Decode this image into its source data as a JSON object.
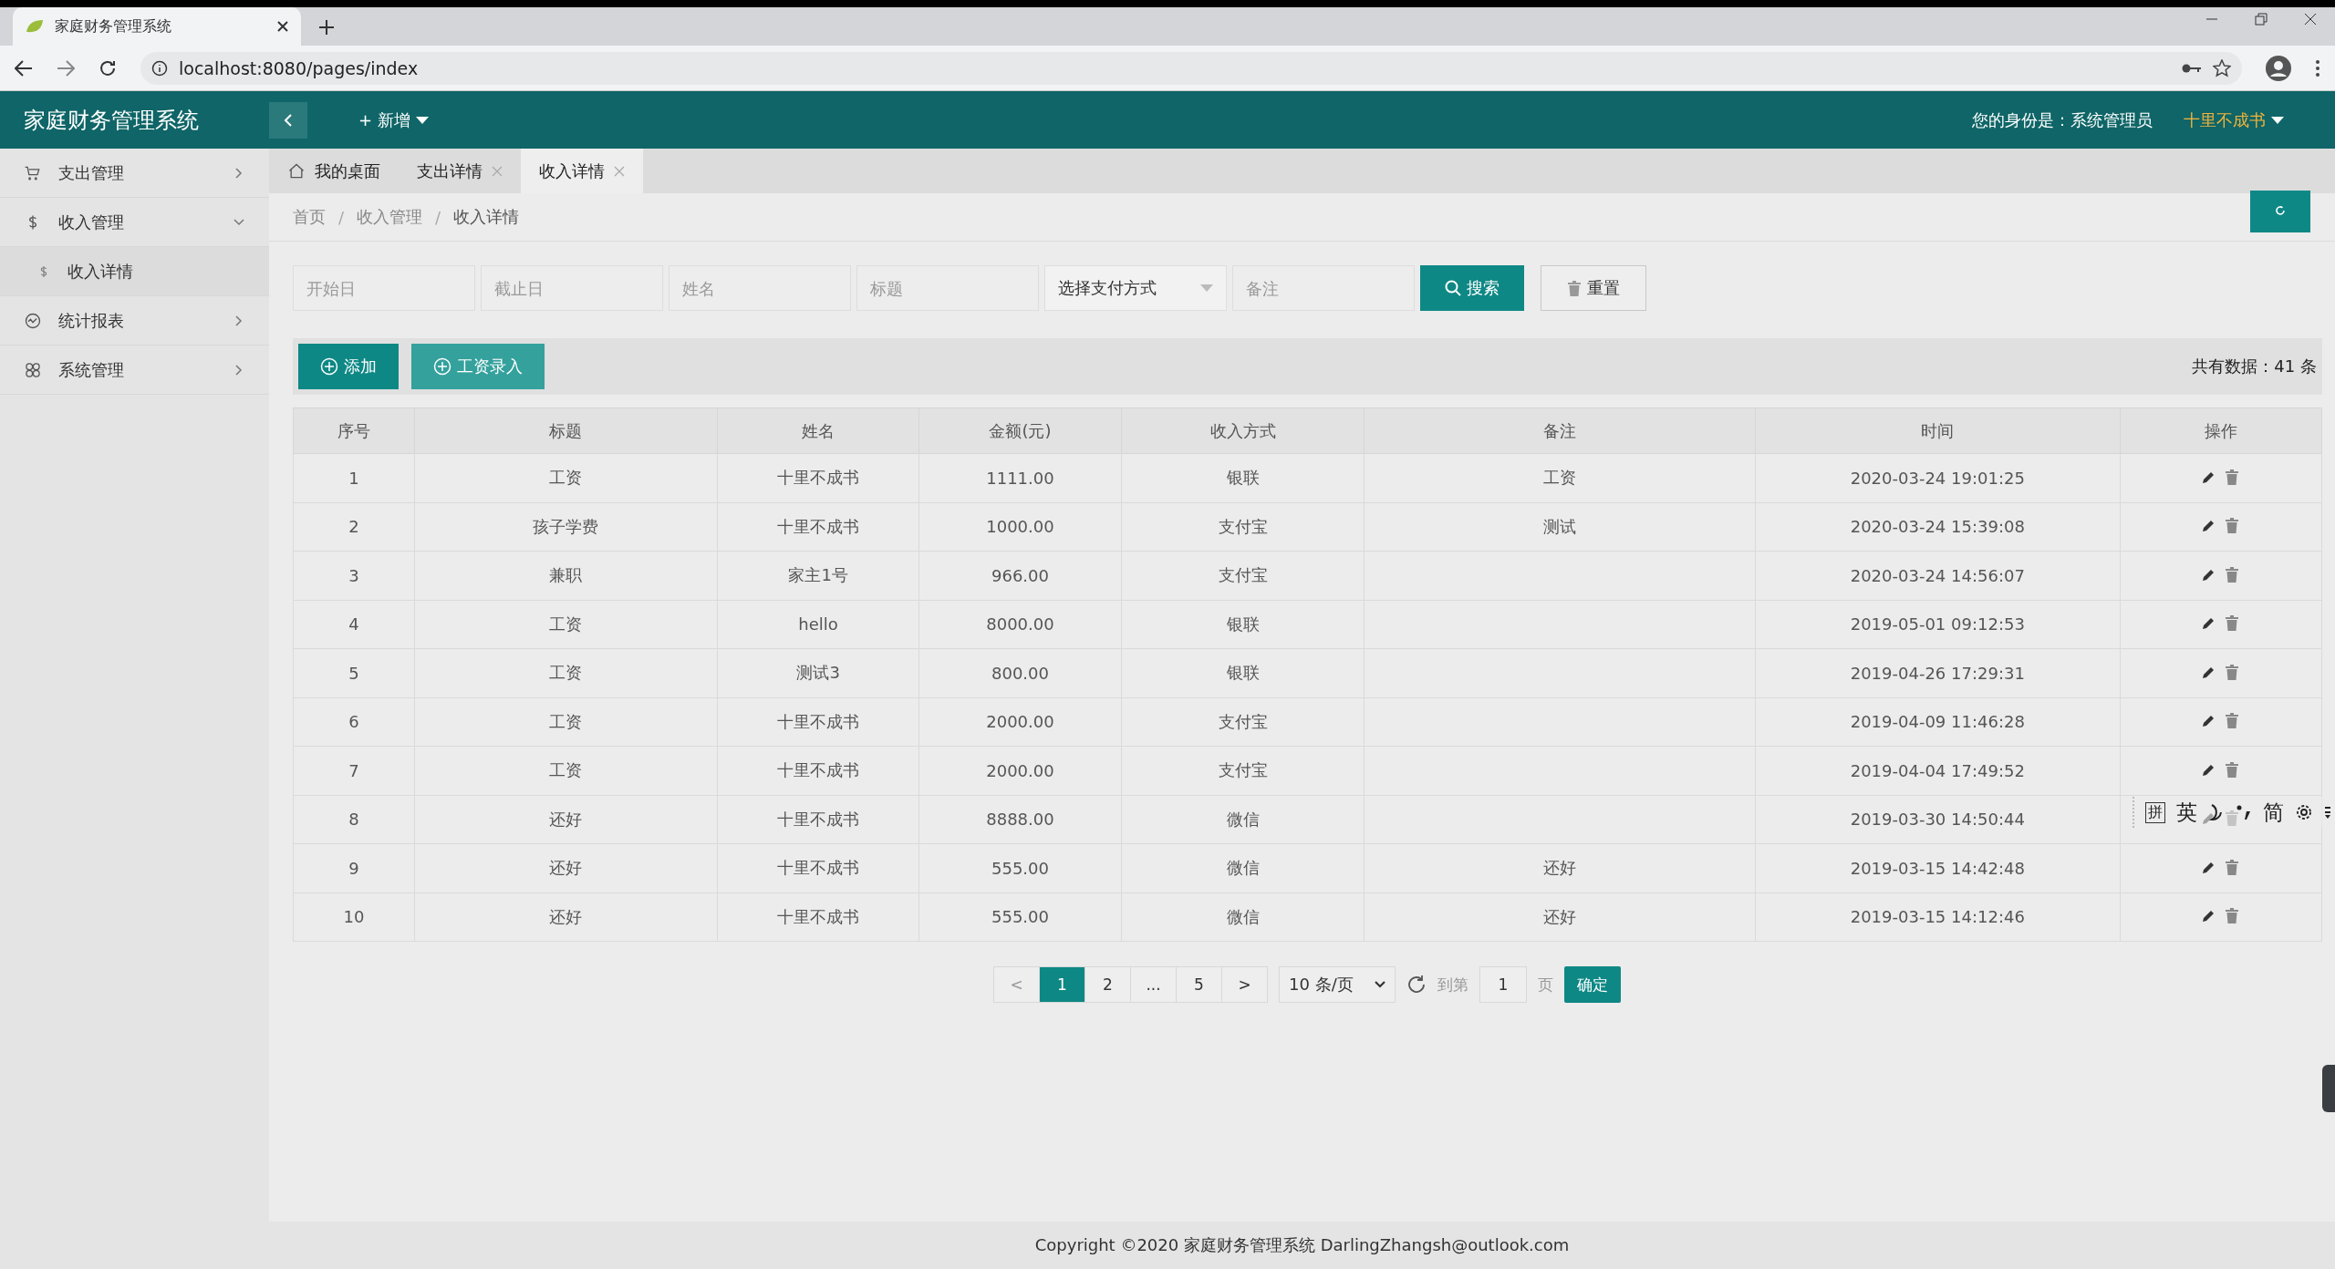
{
  "browser": {
    "tab_title": "家庭财务管理系统",
    "url": "localhost:8080/pages/index"
  },
  "header": {
    "title": "家庭财务管理系统",
    "new_menu": "+ 新增",
    "role_text": "您的身份是：系统管理员",
    "user": "十里不成书"
  },
  "sidebar": {
    "items": [
      {
        "label": "支出管理",
        "expanded": false
      },
      {
        "label": "收入管理",
        "expanded": true,
        "children": [
          {
            "label": "收入详情",
            "selected": true
          }
        ]
      },
      {
        "label": "统计报表",
        "expanded": false
      },
      {
        "label": "系统管理",
        "expanded": false
      }
    ]
  },
  "tabs": [
    {
      "label": "我的桌面",
      "kind": "home",
      "selected": false
    },
    {
      "label": "支出详情",
      "kind": "closable",
      "selected": false
    },
    {
      "label": "收入详情",
      "kind": "closable",
      "selected": true
    }
  ],
  "breadcrumb": {
    "separator": "/",
    "items": [
      "首页",
      "收入管理",
      "收入详情"
    ]
  },
  "filters": [
    {
      "kind": "input",
      "placeholder": "开始日"
    },
    {
      "kind": "input",
      "placeholder": "截止日"
    },
    {
      "kind": "input",
      "placeholder": "姓名"
    },
    {
      "kind": "input",
      "placeholder": "标题"
    },
    {
      "kind": "select",
      "value": "选择支付方式"
    },
    {
      "kind": "input",
      "placeholder": "备注"
    }
  ],
  "search_button": "搜索",
  "reset_button": "重置",
  "toolbar": {
    "buttons": [
      "添加",
      "工资录入"
    ],
    "total": "共有数据：41 条"
  },
  "table": {
    "columns": [
      "序号",
      "标题",
      "姓名",
      "金额(元)",
      "收入方式",
      "备注",
      "时间",
      "操作"
    ],
    "rows": [
      {
        "cells": [
          "1",
          "工资",
          "十里不成书",
          "1111.00",
          "银联",
          "工资",
          "2020-03-24 19:01:25"
        ]
      },
      {
        "cells": [
          "2",
          "孩子学费",
          "十里不成书",
          "1000.00",
          "支付宝",
          "测试",
          "2020-03-24 15:39:08"
        ]
      },
      {
        "cells": [
          "3",
          "兼职",
          "家主1号",
          "966.00",
          "支付宝",
          "",
          "2020-03-24 14:56:07"
        ]
      },
      {
        "cells": [
          "4",
          "工资",
          "hello",
          "8000.00",
          "银联",
          "",
          "2019-05-01 09:12:53"
        ]
      },
      {
        "cells": [
          "5",
          "工资",
          "测试3",
          "800.00",
          "银联",
          "",
          "2019-04-26 17:29:31"
        ]
      },
      {
        "cells": [
          "6",
          "工资",
          "十里不成书",
          "2000.00",
          "支付宝",
          "",
          "2019-04-09 11:46:28"
        ]
      },
      {
        "cells": [
          "7",
          "工资",
          "十里不成书",
          "2000.00",
          "支付宝",
          "",
          "2019-04-04 17:49:52"
        ]
      },
      {
        "cells": [
          "8",
          "还好",
          "十里不成书",
          "8888.00",
          "微信",
          "",
          "2019-03-30 14:50:44"
        ]
      },
      {
        "cells": [
          "9",
          "还好",
          "十里不成书",
          "555.00",
          "微信",
          "还好",
          "2019-03-15 14:42:48"
        ]
      },
      {
        "cells": [
          "10",
          "还好",
          "十里不成书",
          "555.00",
          "微信",
          "还好",
          "2019-03-15 14:12:46"
        ]
      }
    ]
  },
  "pagination": {
    "prev": "<",
    "pages": [
      {
        "label": "1",
        "selected": true
      },
      {
        "label": "2",
        "selected": false
      },
      {
        "label": "...",
        "selected": false
      },
      {
        "label": "5",
        "selected": false
      }
    ],
    "next": ">",
    "page_size": "10 条/页",
    "goto_label": "到第",
    "goto_value": "1",
    "page_unit": "页",
    "confirm": "确定"
  },
  "ime_toolbar": [
    "拼",
    "英",
    "简"
  ],
  "footer": "Copyright ©2020 家庭财务管理系统 DarlingZhangsh@outlook.com"
}
